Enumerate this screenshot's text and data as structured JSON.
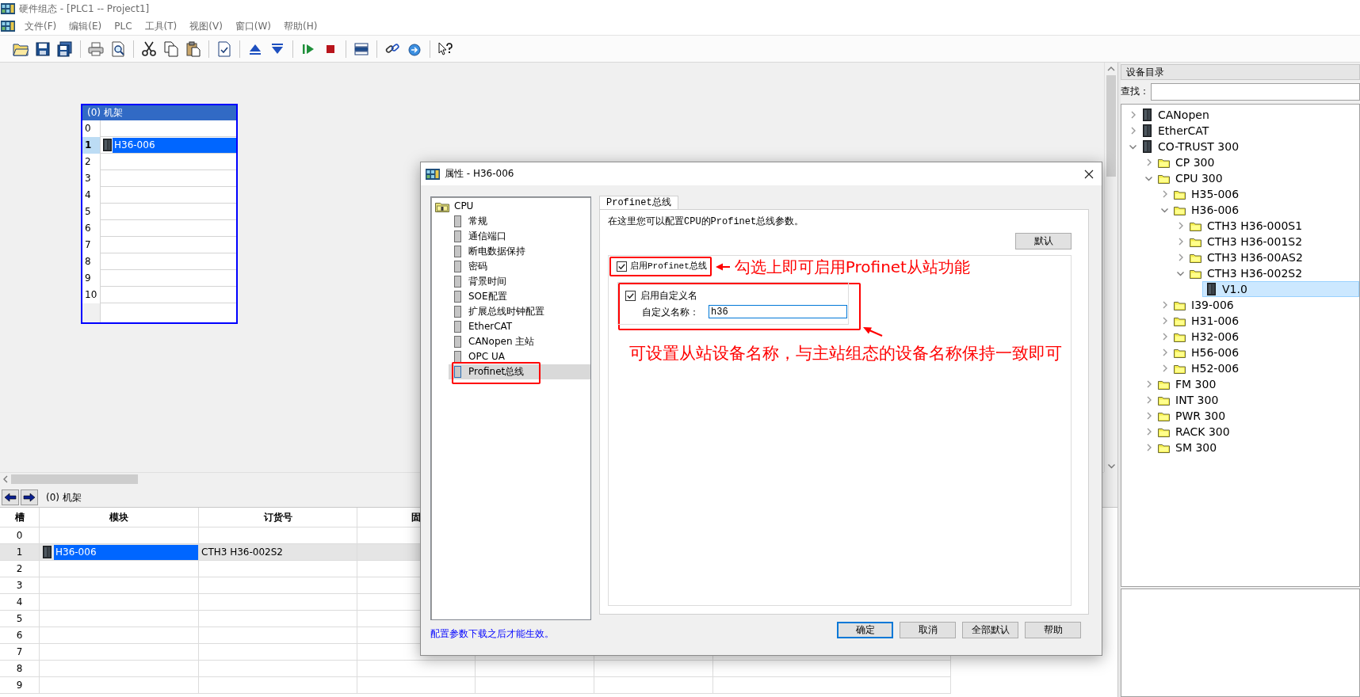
{
  "window": {
    "title": "硬件组态 - [PLC1 -- Project1]"
  },
  "menu": [
    "文件(F)",
    "编辑(E)",
    "PLC",
    "工具(T)",
    "视图(V)",
    "窗口(W)",
    "帮助(H)"
  ],
  "rack": {
    "title": "(0) 机架",
    "slots": [
      {
        "slot": "0",
        "selected": false
      },
      {
        "slot": "1",
        "module": "H36-006",
        "selected": true
      },
      {
        "slot": "2",
        "selected": false
      },
      {
        "slot": "3",
        "selected": false
      },
      {
        "slot": "4",
        "selected": false
      },
      {
        "slot": "5",
        "selected": false
      },
      {
        "slot": "6",
        "selected": false
      },
      {
        "slot": "7",
        "selected": false
      },
      {
        "slot": "8",
        "selected": false
      },
      {
        "slot": "9",
        "selected": false
      },
      {
        "slot": "10",
        "selected": false
      }
    ]
  },
  "module_table": {
    "title": "(0) 机架",
    "columns": [
      "槽",
      "模块",
      "订货号",
      "固"
    ],
    "rows": [
      {
        "slot": "0",
        "selected": false
      },
      {
        "slot": "1",
        "module": "H36-006",
        "order_number": "CTH3 H36-002S2",
        "selected": true
      },
      {
        "slot": "2",
        "selected": false
      },
      {
        "slot": "3",
        "selected": false
      },
      {
        "slot": "4",
        "selected": false
      },
      {
        "slot": "5",
        "selected": false
      },
      {
        "slot": "6",
        "selected": false
      },
      {
        "slot": "7",
        "selected": false
      },
      {
        "slot": "8",
        "selected": false
      },
      {
        "slot": "9",
        "selected": false
      }
    ]
  },
  "catalog": {
    "title": "设备目录",
    "search_label": "查找：",
    "tree": [
      {
        "label": "CANopen",
        "kind": "module",
        "expanded": false,
        "selected": false
      },
      {
        "label": "EtherCAT",
        "kind": "module",
        "expanded": false,
        "selected": false
      },
      {
        "label": "CO-TRUST 300",
        "kind": "module",
        "expanded": true,
        "selected": false,
        "children": [
          {
            "label": "CP 300",
            "kind": "folder",
            "expanded": false,
            "selected": false
          },
          {
            "label": "CPU 300",
            "kind": "folder",
            "expanded": true,
            "selected": false,
            "children": [
              {
                "label": "H35-006",
                "kind": "folder",
                "expanded": false,
                "selected": false
              },
              {
                "label": "H36-006",
                "kind": "folder",
                "expanded": true,
                "selected": false,
                "children": [
                  {
                    "label": "CTH3 H36-000S1",
                    "kind": "folder",
                    "expanded": false,
                    "selected": false
                  },
                  {
                    "label": "CTH3 H36-001S2",
                    "kind": "folder",
                    "expanded": false,
                    "selected": false
                  },
                  {
                    "label": "CTH3 H36-00AS2",
                    "kind": "folder",
                    "expanded": false,
                    "selected": false
                  },
                  {
                    "label": "CTH3 H36-002S2",
                    "kind": "folder",
                    "expanded": true,
                    "selected": false,
                    "children": [
                      {
                        "label": "V1.0",
                        "kind": "module",
                        "selected": true
                      }
                    ]
                  }
                ]
              },
              {
                "label": "I39-006",
                "kind": "folder",
                "expanded": false,
                "selected": false
              },
              {
                "label": "H31-006",
                "kind": "folder",
                "expanded": false,
                "selected": false
              },
              {
                "label": "H32-006",
                "kind": "folder",
                "expanded": false,
                "selected": false
              },
              {
                "label": "H56-006",
                "kind": "folder",
                "expanded": false,
                "selected": false
              },
              {
                "label": "H52-006",
                "kind": "folder",
                "expanded": false,
                "selected": false
              }
            ]
          },
          {
            "label": "FM 300",
            "kind": "folder",
            "expanded": false,
            "selected": false
          },
          {
            "label": "INT 300",
            "kind": "folder",
            "expanded": false,
            "selected": false
          },
          {
            "label": "PWR 300",
            "kind": "folder",
            "expanded": false,
            "selected": false
          },
          {
            "label": "RACK 300",
            "kind": "folder",
            "expanded": false,
            "selected": false
          },
          {
            "label": "SM 300",
            "kind": "folder",
            "expanded": false,
            "selected": false
          }
        ]
      }
    ]
  },
  "dialog": {
    "title": "属性 - H36-006",
    "tree": {
      "label": "CPU",
      "children": [
        {
          "label": "常规",
          "selected": false
        },
        {
          "label": "通信端口",
          "selected": false
        },
        {
          "label": "断电数据保持",
          "selected": false
        },
        {
          "label": "密码",
          "selected": false
        },
        {
          "label": "背景时间",
          "selected": false
        },
        {
          "label": "SOE配置",
          "selected": false
        },
        {
          "label": "扩展总线时钟配置",
          "selected": false
        },
        {
          "label": "EtherCAT",
          "selected": false
        },
        {
          "label": "CANopen 主站",
          "selected": false
        },
        {
          "label": "OPC UA",
          "selected": false
        },
        {
          "label": "Profinet总线",
          "selected": true
        }
      ]
    },
    "note": "配置参数下载之后才能生效。",
    "tab": {
      "label": "Profinet总线",
      "selected": true
    },
    "description": "在这里您可以配置CPU的Profinet总线参数。",
    "default_button": "默认",
    "enable_profinet": {
      "label": "启用Profinet总线",
      "checked": true
    },
    "enable_custom_name": {
      "label": "启用自定义名",
      "checked": true
    },
    "custom_name": {
      "label": "自定义名称：",
      "value": "h36"
    },
    "buttons": [
      {
        "label": "确定",
        "default": true
      },
      {
        "label": "取消",
        "default": false
      },
      {
        "label": "全部默认",
        "default": false
      },
      {
        "label": "帮助",
        "default": false
      }
    ]
  },
  "annotations": [
    {
      "text": "勾选上即可启用Profinet从站功能"
    },
    {
      "text": "可设置从站设备名称，与主站组态的设备名称保持一致即可"
    }
  ]
}
